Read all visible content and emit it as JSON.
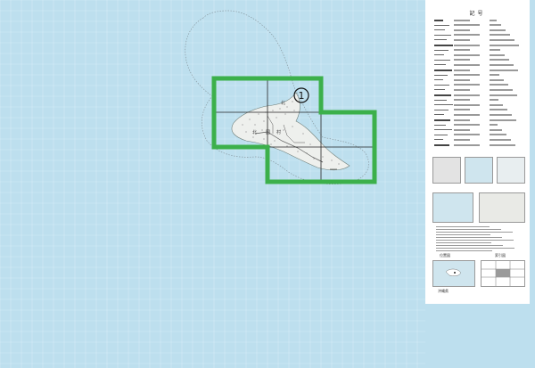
{
  "map": {
    "sheet_number": "①",
    "island_labels": [
      "北",
      "国",
      "村"
    ],
    "legend": {
      "title": "記号",
      "location_map_title": "位置図",
      "index_title": "索引図",
      "prefecture_label": "沖縄県"
    },
    "colors": {
      "sea": "#bddfee",
      "grid": "#dceff8",
      "land": "#eef0ed",
      "sheet_outline": "#3cb04b",
      "index_line": "#222222"
    }
  }
}
